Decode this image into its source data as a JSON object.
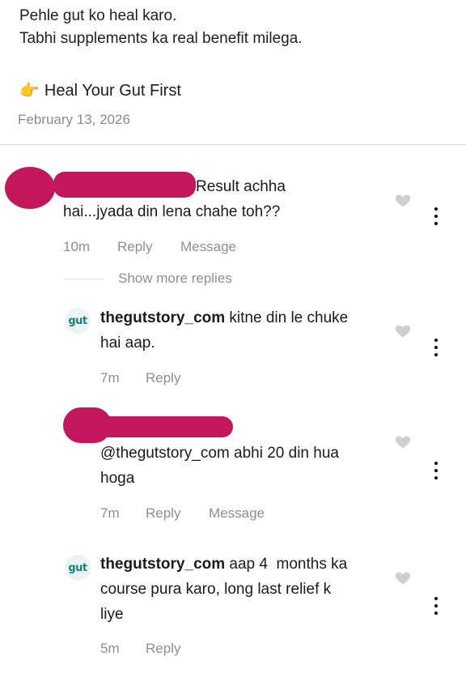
{
  "post": {
    "caption_line1": "Pehle gut ko heal karo.",
    "caption_line2": "Tabhi supplements ka real benefit milega.",
    "cta_emoji": "👉",
    "cta_text": "Heal Your Gut First",
    "date": "February 13, 2026"
  },
  "show_more_replies": "Show more replies",
  "comments": [
    {
      "text_line1": "Result achha",
      "text_line2": "hai...jyada din lena chahe toh??",
      "time": "10m",
      "reply": "Reply",
      "message": "Message"
    },
    {
      "avatar": "gut",
      "username": "thegutstory_com",
      "text_line1_rest": " kitne din le chuke",
      "text_line2": "hai aap.",
      "time": "7m",
      "reply": "Reply"
    },
    {
      "text_line1": "@thegutstory_com abhi 20 din hua",
      "text_line2": "hoga",
      "time": "7m",
      "reply": "Reply",
      "message": "Message"
    },
    {
      "avatar": "gut",
      "username": "thegutstory_com",
      "text_line1_rest": " aap 4  months ka",
      "text_line2": "course pura karo, long last relief k",
      "text_line3": "liye",
      "time": "5m",
      "reply": "Reply"
    }
  ],
  "colors": {
    "redaction": "#c2185b",
    "meta_gray": "#8e8e8e",
    "brand_teal": "#1a7f78"
  },
  "icons": [
    "heart-outline-icon",
    "kebab-menu-icon",
    "pointing-hand-emoji"
  ]
}
